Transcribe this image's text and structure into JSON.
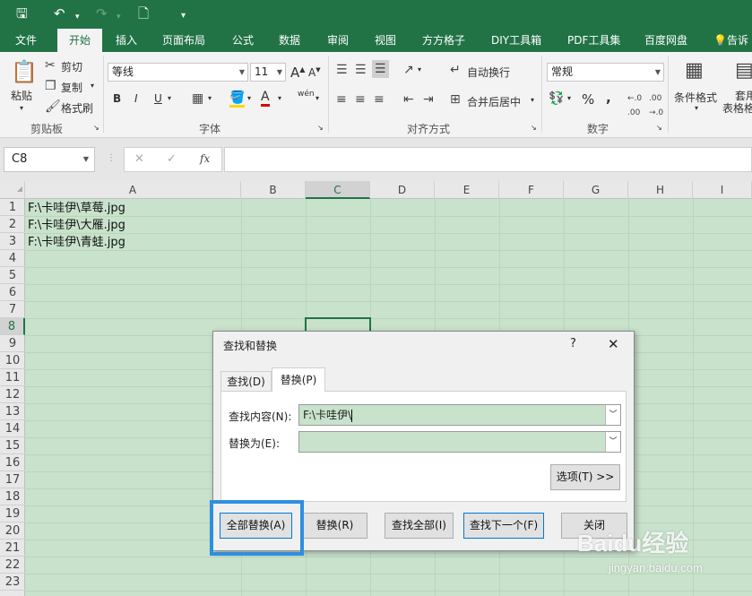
{
  "qat": {
    "save_icon": "save-icon",
    "undo_icon": "undo-icon",
    "redo_icon": "redo-icon",
    "new_icon": "new-file-icon",
    "customize_icon": "customize-icon"
  },
  "tabs": [
    "文件",
    "开始",
    "插入",
    "页面布局",
    "公式",
    "数据",
    "审阅",
    "视图",
    "方方格子",
    "DIY工具箱",
    "PDF工具集",
    "百度网盘",
    "告诉"
  ],
  "ribbon": {
    "clipboard": {
      "paste": "粘贴",
      "cut": "剪切",
      "copy": "复制",
      "format_painter": "格式刷",
      "group": "剪贴板"
    },
    "font": {
      "name": "等线",
      "size": "11",
      "bold": "B",
      "italic": "I",
      "underline": "U",
      "grow": "A",
      "shrink": "A",
      "font_color": "A",
      "wen": "wén",
      "group": "字体"
    },
    "alignment": {
      "wrap": "自动换行",
      "merge": "合并后居中",
      "group": "对齐方式"
    },
    "number": {
      "format": "常规",
      "percent": "%",
      "comma": ",",
      "group": "数字"
    },
    "styles": {
      "conditional": "条件格式",
      "table_a": "套用",
      "table_b": "表格格"
    }
  },
  "formula_bar": {
    "name_box": "C8",
    "cancel": "✕",
    "enter": "✓",
    "fx": "fx",
    "value": ""
  },
  "columns": [
    "A",
    "B",
    "C",
    "D",
    "E",
    "F",
    "G",
    "H",
    "I"
  ],
  "rows": [
    "1",
    "2",
    "3",
    "4",
    "5",
    "6",
    "7",
    "8",
    "9",
    "10",
    "11",
    "12",
    "13",
    "14",
    "15",
    "16",
    "17",
    "18",
    "19",
    "20",
    "21",
    "22",
    "23"
  ],
  "cells": {
    "A1": "F:\\卡哇伊\\草莓.jpg",
    "A2": "F:\\卡哇伊\\大雁.jpg",
    "A3": "F:\\卡哇伊\\青蛙.jpg"
  },
  "dialog": {
    "title": "查找和替换",
    "help": "?",
    "close": "✕",
    "tab_find": "查找(D)",
    "tab_replace": "替换(P)",
    "find_label": "查找内容(N):",
    "find_value": "F:\\卡哇伊\\",
    "replace_label": "替换为(E):",
    "replace_value": "",
    "options": "选项(T) >>",
    "replace_all": "全部替换(A)",
    "replace": "替换(R)",
    "find_all": "查找全部(I)",
    "find_next": "查找下一个(F)",
    "close_btn": "关闭"
  },
  "watermark": {
    "text": "Baidu经验",
    "url": "jingyan.baidu.com"
  },
  "highlight_color": "#2e8fe0"
}
